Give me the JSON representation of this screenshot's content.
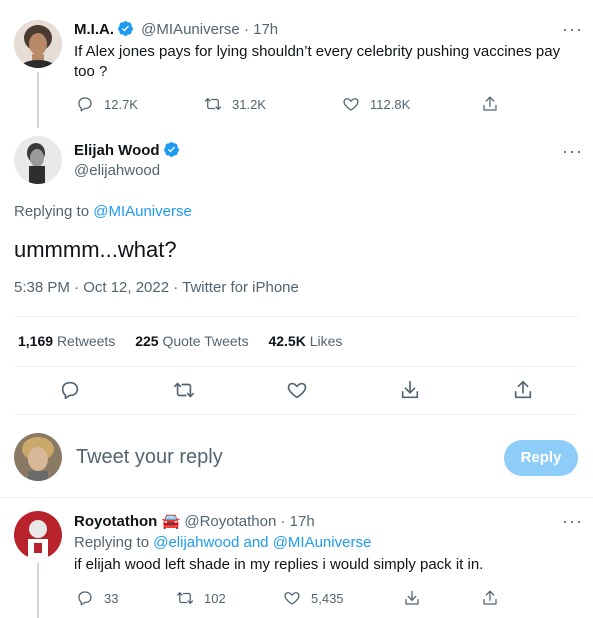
{
  "parent_tweet": {
    "display_name": "M.I.A.",
    "handle": "@MIAuniverse",
    "time": "· 17h",
    "text": "If Alex jones pays for lying shouldn’t every celebrity pushing vaccines pay too ?",
    "replies": "12.7K",
    "retweets": "31.2K",
    "likes": "112.8K"
  },
  "main_tweet": {
    "display_name": "Elijah Wood",
    "handle": "@elijahwood",
    "replying_to_label": "Replying to",
    "replying_to_handle": "@MIAuniverse",
    "text": "ummmm...what?",
    "timestamp": "5:38 PM · Oct 12, 2022 · Twitter for iPhone",
    "retweets_count": "1,169",
    "retweets_label": "Retweets",
    "quote_count": "225",
    "quote_label": "Quote Tweets",
    "likes_count": "42.5K",
    "likes_label": "Likes"
  },
  "reply_box": {
    "placeholder": "Tweet your reply",
    "button_label": "Reply"
  },
  "reply_tweet": {
    "display_name": "Royotathon",
    "emoji": "🚘",
    "handle": "@Royotathon",
    "time": "· 17h",
    "replying_to_label": "Replying to",
    "replying_to_handles": "@elijahwood and @MIAuniverse",
    "text": "if elijah wood left shade in my replies i would simply pack it in.",
    "replies": "33",
    "retweets": "102",
    "likes": "5,435"
  },
  "colors": {
    "accent": "#1d9bf0",
    "reply_button_disabled": "#8ecdf8",
    "text_secondary": "#536471"
  }
}
